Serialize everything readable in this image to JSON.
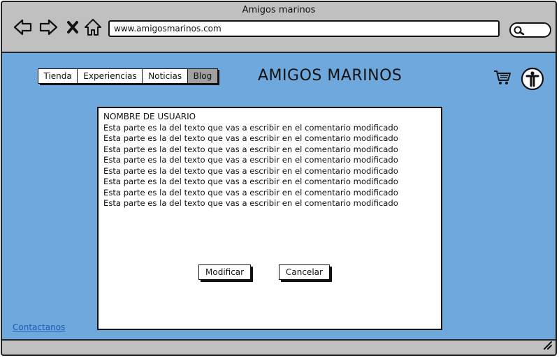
{
  "window": {
    "title": "Amigos marinos"
  },
  "toolbar": {
    "icons": [
      "back-arrow-icon",
      "forward-arrow-icon",
      "close-icon",
      "home-icon"
    ],
    "url": "www.amigosmarinos.com",
    "search_icon": "search-icon"
  },
  "nav": {
    "tabs": [
      {
        "label": "Tienda",
        "active": false
      },
      {
        "label": "Experiencias",
        "active": false
      },
      {
        "label": "Noticias",
        "active": false
      },
      {
        "label": "Blog",
        "active": true
      }
    ]
  },
  "site": {
    "title": "AMIGOS MARINOS",
    "cart_icon": "cart-icon",
    "user_icon": "user-icon"
  },
  "comment": {
    "username": "NOMBRE DE USUARIO",
    "lines": [
      "Esta parte es la del texto que vas a escribir en el comentario modificado",
      "Esta parte es la del texto que vas a escribir en el comentario modificado",
      "Esta parte es la del texto que vas a escribir en el comentario modificado",
      "Esta parte es la del texto que vas a escribir en el comentario modificado",
      "Esta parte es la del texto que vas a escribir en el comentario modificado",
      "Esta parte es la del texto que vas a escribir en el comentario modificado",
      "Esta parte es la del texto que vas a escribir en el comentario modificado",
      "Esta parte es la del texto que vas a escribir en el comentario modificado"
    ],
    "modify_label": "Modificar",
    "cancel_label": "Cancelar"
  },
  "footer": {
    "contact_link": "Contactanos"
  },
  "colors": {
    "chrome": "#c0c0c0",
    "content_bg": "#6fa8dc",
    "active_tab": "#a0a0a0",
    "link": "#1a5fb4"
  }
}
